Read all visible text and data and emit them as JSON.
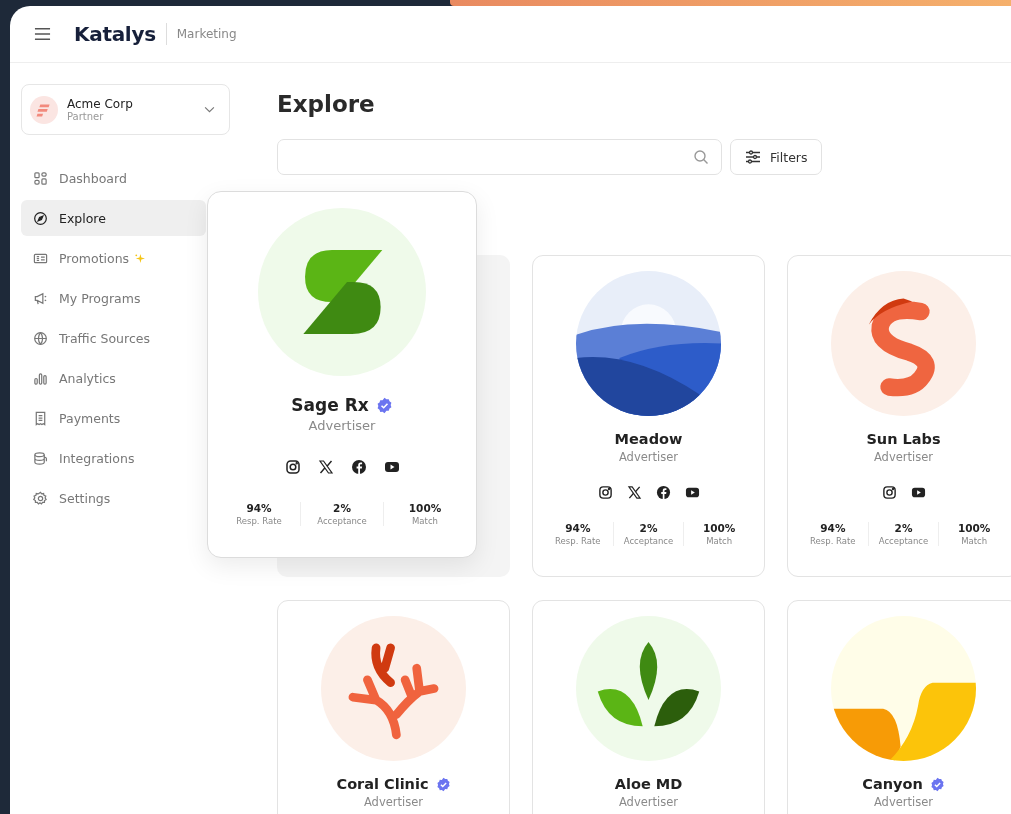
{
  "header": {
    "logo": "Katalys",
    "section": "Marketing"
  },
  "account": {
    "name": "Acme Corp",
    "role": "Partner"
  },
  "nav": [
    {
      "label": "Dashboard",
      "selected": false,
      "sparkle": false
    },
    {
      "label": "Explore",
      "selected": true,
      "sparkle": false
    },
    {
      "label": "Promotions",
      "selected": false,
      "sparkle": true
    },
    {
      "label": "My Programs",
      "selected": false,
      "sparkle": false
    },
    {
      "label": "Traffic Sources",
      "selected": false,
      "sparkle": false
    },
    {
      "label": "Analytics",
      "selected": false,
      "sparkle": false
    },
    {
      "label": "Payments",
      "selected": false,
      "sparkle": false
    },
    {
      "label": "Integrations",
      "selected": false,
      "sparkle": false
    },
    {
      "label": "Settings",
      "selected": false,
      "sparkle": false
    }
  ],
  "page": {
    "title": "Explore",
    "filters_button": "Filters"
  },
  "cards": [
    {
      "name": "Sage Rx",
      "verified": true,
      "role": "Advertiser",
      "lifted": true,
      "socials": [
        {
          "kind": "instagram"
        },
        {
          "kind": "x"
        },
        {
          "kind": "facebook"
        },
        {
          "kind": "youtube"
        }
      ],
      "stats": [
        {
          "value": "94%",
          "label": "Resp. Rate"
        },
        {
          "value": "2%",
          "label": "Acceptance"
        },
        {
          "value": "100%",
          "label": "Match"
        }
      ]
    },
    {
      "name": "Meadow",
      "verified": false,
      "role": "Advertiser",
      "lifted": false,
      "socials": [
        {
          "kind": "instagram"
        },
        {
          "kind": "x"
        },
        {
          "kind": "facebook"
        },
        {
          "kind": "youtube"
        }
      ],
      "stats": [
        {
          "value": "94%",
          "label": "Resp. Rate"
        },
        {
          "value": "2%",
          "label": "Acceptance"
        },
        {
          "value": "100%",
          "label": "Match"
        }
      ]
    },
    {
      "name": "Sun Labs",
      "verified": false,
      "role": "Advertiser",
      "lifted": false,
      "socials": [
        {
          "kind": "instagram"
        },
        {
          "kind": "youtube"
        }
      ],
      "stats": [
        {
          "value": "94%",
          "label": "Resp. Rate"
        },
        {
          "value": "2%",
          "label": "Acceptance"
        },
        {
          "value": "100%",
          "label": "Match"
        }
      ]
    },
    {
      "name": "Coral Clinic",
      "verified": true,
      "role": "Advertiser",
      "lifted": false
    },
    {
      "name": "Aloe MD",
      "verified": false,
      "role": "Advertiser",
      "lifted": false
    },
    {
      "name": "Canyon",
      "verified": true,
      "role": "Advertiser",
      "lifted": false
    }
  ]
}
